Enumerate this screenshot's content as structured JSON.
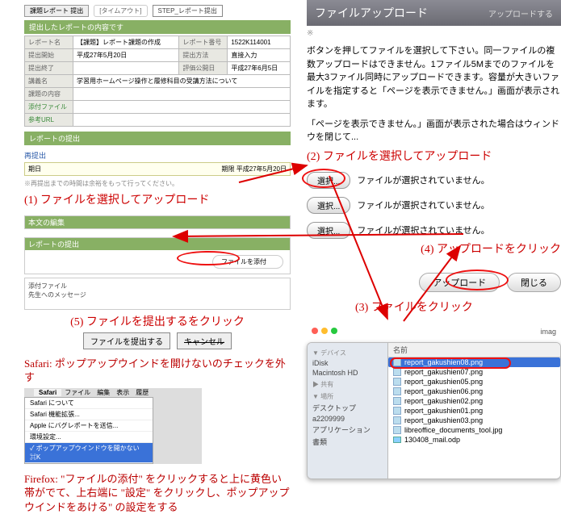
{
  "left": {
    "tabs": {
      "active": "課題レポート 提出",
      "b1": "[タイムアウト]",
      "b2": "STEP_レポート提出"
    },
    "greenbar1": "提出したレポートの内容です",
    "rows": {
      "r1a": "レポート名",
      "r1b": "【課題】レポート課題の作成",
      "r1c": "レポート番号",
      "r1d": "1522K114001",
      "r2a": "提出開始",
      "r2b": "平成27年5月20日",
      "r2c": "提出方法",
      "r2d": "直接入力",
      "r3a": "提出終了",
      "r3b": "",
      "r3c": "評価公開日",
      "r3d": "平成27年6月5日",
      "r4a": "講義名",
      "r4b": "学習用ホームページ操作と履修科目の受講方法について",
      "r5a": "課題の内容",
      "r6a": "添付ファイル",
      "r7a": "参考URL"
    },
    "rbar": "レポートの提出",
    "resubmit": {
      "title": "再提出",
      "left": "期日",
      "right": "期限 平成27年5月20日",
      "note": "※再提出までの時間は余裕をもって行ってください。"
    },
    "sec1": "本文の編集",
    "sec2": "レポートの提出",
    "attach_btn": "ファイルを添付",
    "msgbox": {
      "l1": "添付ファイル",
      "l2": "先生へのメッセージ"
    },
    "step1": "(1) ファイルを選択してアップロード",
    "step5": "(5) ファイルを提出するをクリック",
    "submit": "ファイルを提出する",
    "cancel": "キャンセル",
    "safari_note": "Safari: ポップアップウインドを開けないのチェックを外す",
    "safari_menu": {
      "name": "Safari",
      "m1": "ファイル",
      "m2": "編集",
      "m3": "表示",
      "m4": "履歴",
      "i1": "Safari について",
      "i2": "Safari 機能拡張...",
      "i3": "Apple にバグレポートを送信...",
      "i4": "環境設定...",
      "i5": "✓ ポップアップウインドウを開かない ⌘K"
    },
    "firefox_note": "Firefox: \"ファイルの添付\" をクリックすると上に黄色い帯がでて、上右端に \"設定\" をクリックし、ポップアップウインドをあける\" の設定をする"
  },
  "right": {
    "title": "ファイルアップロード",
    "subtitle": "アップロードする",
    "asterisk": "※",
    "para": "ボタンを押してファイルを選択して下さい。同一ファイルの複数アップロードはできません。1ファイル5Mまでのファイルを最大3ファイル同時にアップロードできます。容量が大きいファイルを指定すると「ページを表示できません。」画面が表示されます。",
    "para2": "「ページを表示できません。」画面が表示された場合はウィンドウを閉じて...",
    "step2": "(2) ファイルを選択してアップロード",
    "select_btn": "選択...",
    "not_selected": "ファイルが選択されていません。",
    "step4": "(4) アップロードをクリック",
    "upload": "アップロード",
    "close": "閉じる",
    "step3": "(3) ファイルをクリック",
    "finder": {
      "title": "imag",
      "col": "名前",
      "side": {
        "dev": "▼ デバイス",
        "d1": "iDisk",
        "d2": "Macintosh HD",
        "share": "▶ 共有",
        "places": "▼ 場所",
        "p1": "デスクトップ",
        "p2": "a2209999",
        "p3": "アプリケーション",
        "p4": "書類"
      },
      "files": [
        "report_gakushien08.png",
        "report_gakushien07.png",
        "report_gakushien05.png",
        "report_gakushien06.png",
        "report_gakushien02.png",
        "report_gakushien01.png",
        "report_gakushien03.png",
        "libreoffice_documents_tool.jpg",
        "130408_mail.odp"
      ]
    }
  }
}
